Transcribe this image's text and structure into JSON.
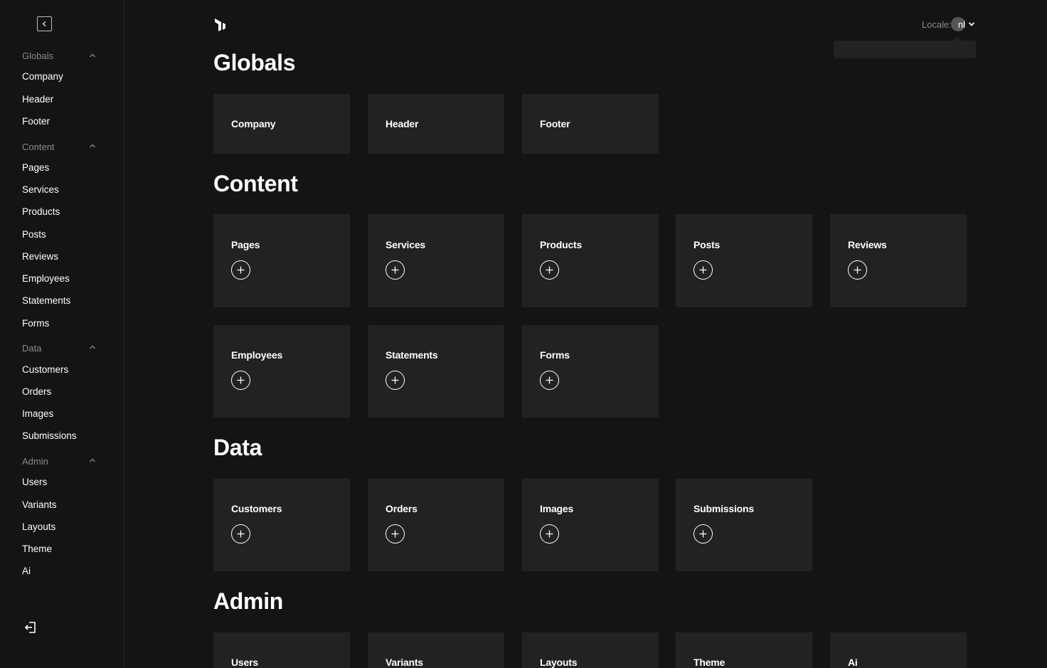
{
  "sidebar": {
    "groups": [
      {
        "label": "Globals",
        "items": [
          "Company",
          "Header",
          "Footer"
        ]
      },
      {
        "label": "Content",
        "items": [
          "Pages",
          "Services",
          "Products",
          "Posts",
          "Reviews",
          "Employees",
          "Statements",
          "Forms"
        ]
      },
      {
        "label": "Data",
        "items": [
          "Customers",
          "Orders",
          "Images",
          "Submissions"
        ]
      },
      {
        "label": "Admin",
        "items": [
          "Users",
          "Variants",
          "Layouts",
          "Theme",
          "Ai"
        ]
      }
    ]
  },
  "header": {
    "locale_label": "Locale:",
    "locale_value": "nl"
  },
  "sections": [
    {
      "title": "Globals",
      "cards": [
        "Company",
        "Header",
        "Footer"
      ]
    },
    {
      "title": "Content",
      "cards": [
        "Pages",
        "Services",
        "Products",
        "Posts",
        "Reviews",
        "Employees",
        "Statements",
        "Forms"
      ]
    },
    {
      "title": "Data",
      "cards": [
        "Customers",
        "Orders",
        "Images",
        "Submissions"
      ]
    },
    {
      "title": "Admin",
      "cards": [
        "Users",
        "Variants",
        "Layouts",
        "Theme",
        "Ai"
      ]
    }
  ],
  "colors": {
    "background": "#141414",
    "card": "#222222",
    "muted_text": "#8a8a8a"
  }
}
